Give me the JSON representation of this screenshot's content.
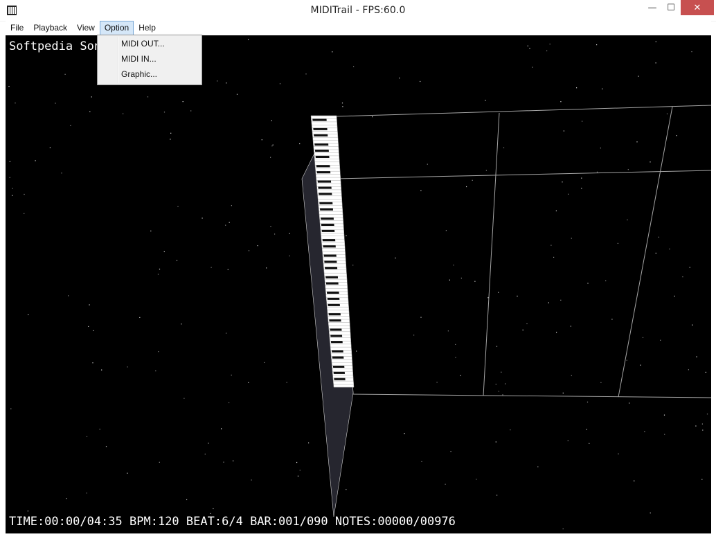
{
  "window": {
    "title": "MIDITrail - FPS:60.0",
    "controls": {
      "minimize": "—",
      "maximize": "☐",
      "close": "✕"
    }
  },
  "menubar": {
    "items": [
      {
        "label": "File"
      },
      {
        "label": "Playback"
      },
      {
        "label": "View"
      },
      {
        "label": "Option",
        "active": true
      },
      {
        "label": "Help"
      }
    ]
  },
  "option_menu": {
    "items": [
      {
        "label": "MIDI OUT..."
      },
      {
        "label": "MIDI IN..."
      },
      {
        "label": "Graphic..."
      }
    ]
  },
  "scene": {
    "song_title": "Softpedia Song",
    "status": {
      "time": "TIME:00:00/04:35",
      "bpm": "BPM:120",
      "beat": "BEAT:6/4",
      "bar": "BAR:001/090",
      "notes": "NOTES:00000/00976"
    },
    "colors": {
      "background": "#000000",
      "grid": "#a0a0a0",
      "keyboard_shadow": "#25252e",
      "white_keys": "#ffffff",
      "black_keys": "#111111"
    }
  }
}
